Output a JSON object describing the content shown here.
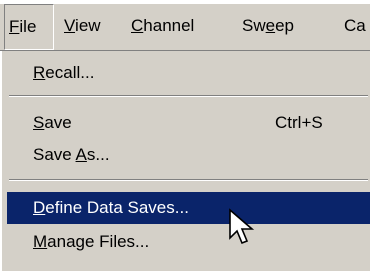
{
  "menubar": {
    "items": [
      {
        "pre": "",
        "u": "F",
        "post": "ile"
      },
      {
        "pre": "",
        "u": "V",
        "post": "iew"
      },
      {
        "pre": "",
        "u": "C",
        "post": "hannel"
      },
      {
        "pre": "Sw",
        "u": "e",
        "post": "ep"
      },
      {
        "pre": "",
        "u": "",
        "post": "Ca"
      }
    ]
  },
  "file_menu": {
    "recall": {
      "pre": "",
      "u": "R",
      "post": "ecall..."
    },
    "save": {
      "pre": "",
      "u": "S",
      "post": "ave",
      "shortcut": "Ctrl+S"
    },
    "save_as": {
      "pre": "Save ",
      "u": "A",
      "post": "s..."
    },
    "define_data_saves": {
      "pre": "",
      "u": "D",
      "post": "efine Data Saves..."
    },
    "manage_files": {
      "pre": "",
      "u": "M",
      "post": "anage Files..."
    }
  },
  "colors": {
    "menu_bg": "#d4d0c8",
    "highlight_bg": "#0a246a",
    "highlight_fg": "#ffffff"
  },
  "cursor_icon": "arrow-cursor-icon"
}
